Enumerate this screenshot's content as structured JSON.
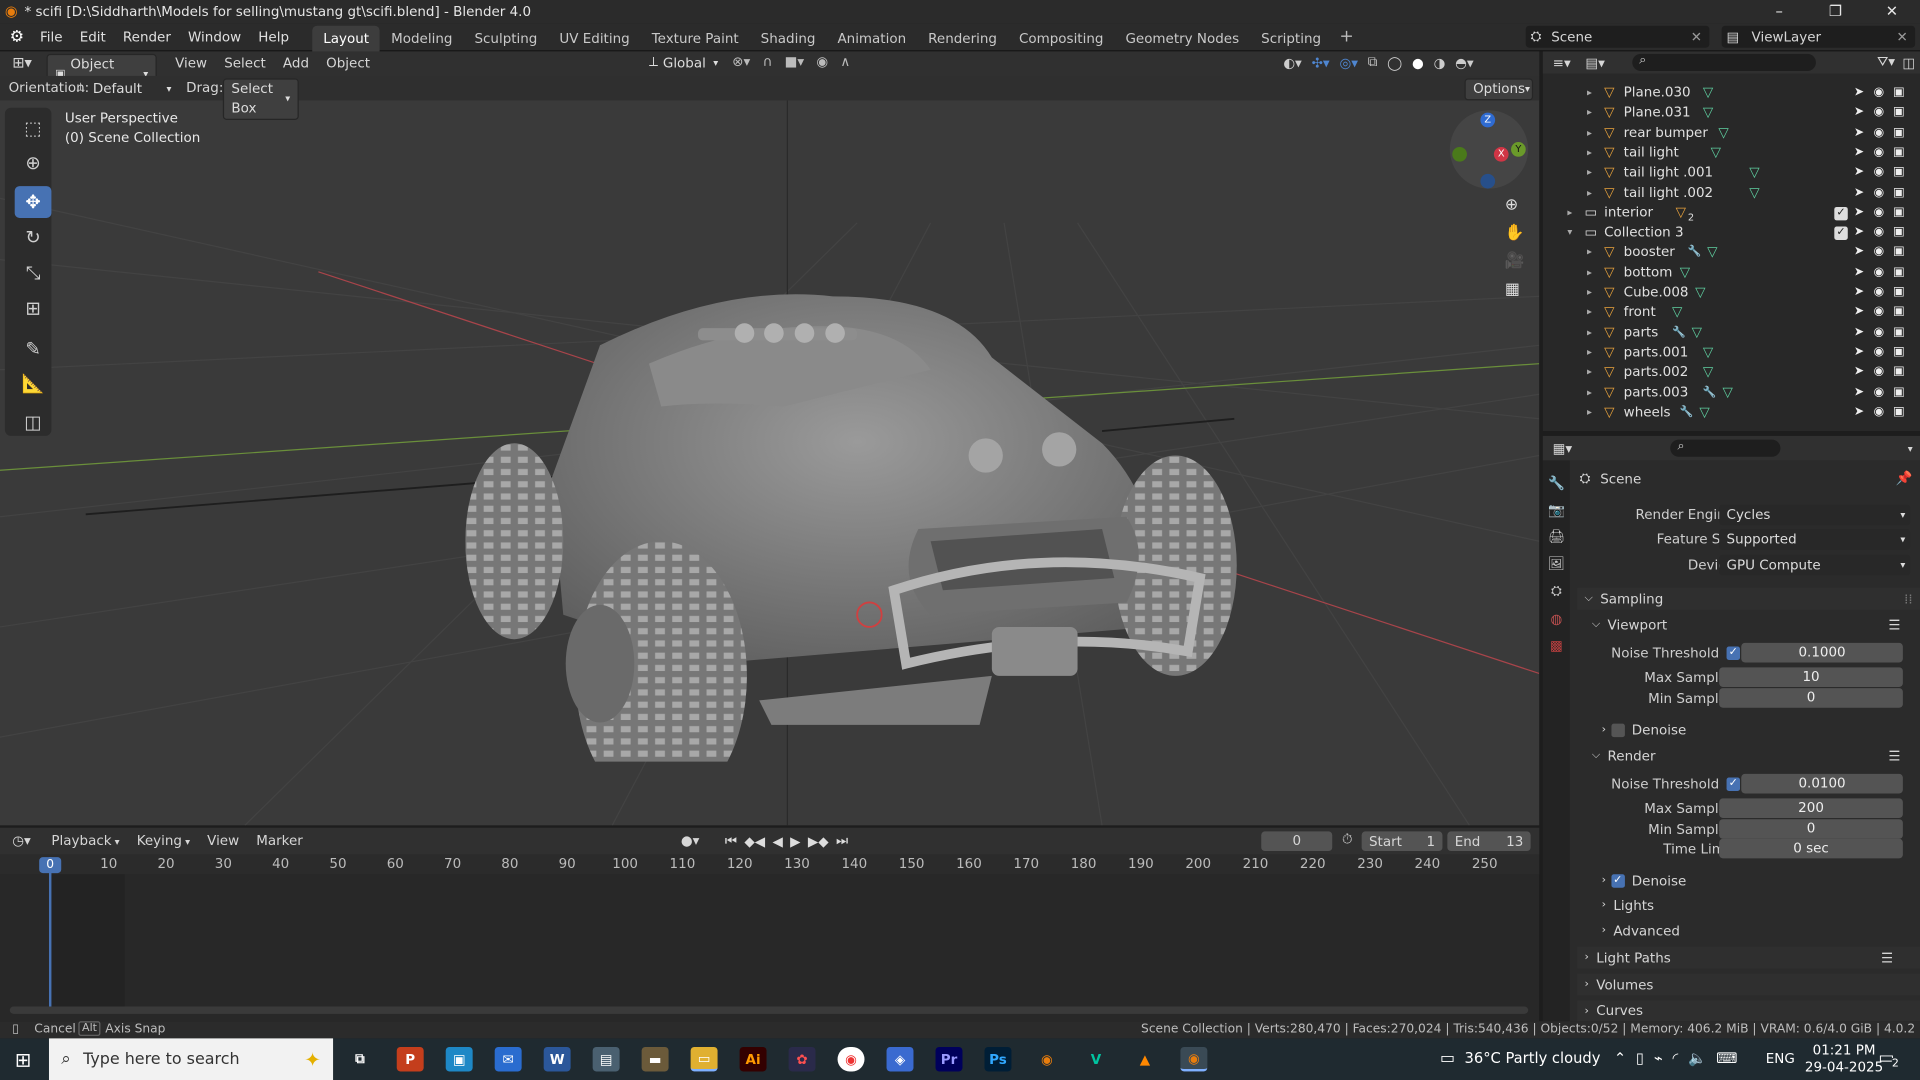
{
  "window": {
    "title": "* scifi [D:\\Siddharth\\Models for selling\\mustang gt\\scifi.blend] - Blender 4.0",
    "min": "–",
    "max": "❐",
    "close": "✕"
  },
  "menu": [
    "File",
    "Edit",
    "Render",
    "Window",
    "Help"
  ],
  "workspaces": [
    "Layout",
    "Modeling",
    "Sculpting",
    "UV Editing",
    "Texture Paint",
    "Shading",
    "Animation",
    "Rendering",
    "Compositing",
    "Geometry Nodes",
    "Scripting"
  ],
  "workspace_add": "+",
  "scene": {
    "name": "Scene",
    "viewlayer": "ViewLayer"
  },
  "viewport": {
    "mode": "Object Mode",
    "menus": [
      "View",
      "Select",
      "Add",
      "Object"
    ],
    "transform": "Global",
    "orientation_label": "Orientation:",
    "orientation_value": "Default",
    "drag_label": "Drag:",
    "drag_value": "Select Box",
    "options": "Options",
    "overlay_line1": "User Perspective",
    "overlay_line2": "(0) Scene Collection",
    "gizmo": {
      "x": "X",
      "y": "Y",
      "z": "Z"
    }
  },
  "timeline": {
    "menus": [
      "Playback",
      "Keying",
      "View",
      "Marker"
    ],
    "current_frame": "0",
    "start_label": "Start",
    "start": "1",
    "end_label": "End",
    "end": "13",
    "ticks": [
      "0",
      "10",
      "20",
      "30",
      "40",
      "50",
      "60",
      "70",
      "80",
      "90",
      "100",
      "110",
      "120",
      "130",
      "140",
      "150",
      "160",
      "170",
      "180",
      "190",
      "200",
      "210",
      "220",
      "230",
      "240",
      "250"
    ]
  },
  "outliner": {
    "rows": [
      {
        "name": "Plane.030",
        "indent": 2
      },
      {
        "name": "Plane.031",
        "indent": 2
      },
      {
        "name": "rear bumper",
        "indent": 2
      },
      {
        "name": "tail light",
        "indent": 2
      },
      {
        "name": "tail light .001",
        "indent": 2
      },
      {
        "name": "tail light .002",
        "indent": 2
      },
      {
        "name": "interior",
        "indent": 1,
        "badge": "2",
        "collection": true
      },
      {
        "name": "Collection 3",
        "indent": 1,
        "collection": true,
        "open": true
      },
      {
        "name": "booster",
        "indent": 2,
        "mod": true
      },
      {
        "name": "bottom",
        "indent": 2
      },
      {
        "name": "Cube.008",
        "indent": 2
      },
      {
        "name": "front",
        "indent": 2
      },
      {
        "name": "parts",
        "indent": 2,
        "mod": true
      },
      {
        "name": "parts.001",
        "indent": 2
      },
      {
        "name": "parts.002",
        "indent": 2
      },
      {
        "name": "parts.003",
        "indent": 2,
        "mod": true
      },
      {
        "name": "wheels",
        "indent": 2,
        "mod": true
      }
    ]
  },
  "properties": {
    "context": "Scene",
    "render_engine_label": "Render Engine",
    "render_engine": "Cycles",
    "feature_set_label": "Feature Set",
    "feature_set": "Supported",
    "device_label": "Device",
    "device": "GPU Compute",
    "sampling": "Sampling",
    "viewport_panel": "Viewport",
    "noise_threshold_label": "Noise Threshold",
    "vp_noise_threshold": "0.1000",
    "max_samples_label": "Max Samples",
    "vp_max_samples": "10",
    "min_samples_label": "Min Samples",
    "vp_min_samples": "0",
    "denoise_label": "Denoise",
    "render_panel": "Render",
    "r_noise_threshold": "0.0100",
    "r_max_samples": "200",
    "r_min_samples": "0",
    "time_limit_label": "Time Limit",
    "r_time_limit": "0 sec",
    "lights": "Lights",
    "advanced": "Advanced",
    "light_paths": "Light Paths",
    "volumes": "Volumes",
    "curves": "Curves"
  },
  "status": {
    "cancel": "Cancel",
    "alt": "Alt",
    "axis_snap": "Axis Snap",
    "stats": "Scene Collection | Verts:280,470 | Faces:270,024 | Tris:540,436 | Objects:0/52 | Memory: 406.2 MiB | VRAM: 0.6/4.0 GiB | 4.0.2"
  },
  "taskbar": {
    "search_placeholder": "Type here to search",
    "weather": "36°C  Partly cloudy",
    "lang": "ENG",
    "time": "01:21 PM",
    "date": "29-04-2025",
    "notifications": "2"
  },
  "colors": {
    "accent": "#4772b3",
    "mesh_icon": "#e8a23c",
    "data_icon": "#5fcfa0"
  }
}
